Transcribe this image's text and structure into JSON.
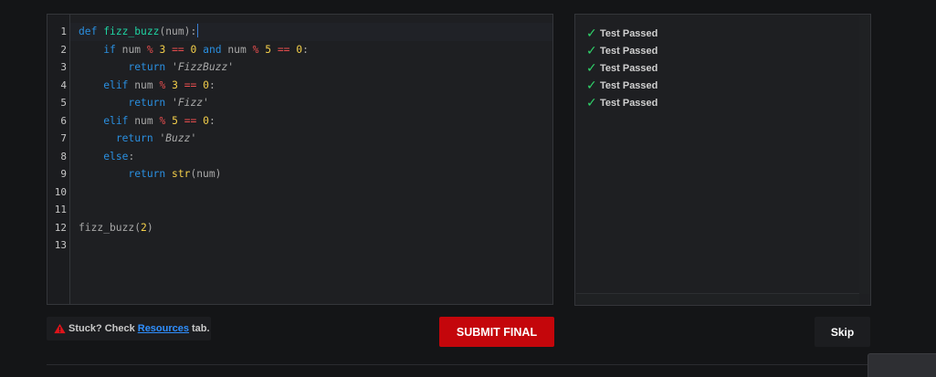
{
  "editor": {
    "line_numbers": [
      "1",
      "2",
      "3",
      "4",
      "5",
      "6",
      "7",
      "8",
      "9",
      "10",
      "11",
      "12",
      "13"
    ],
    "code": {
      "l1": {
        "kw": "def",
        "fn": "fizz_buzz",
        "rest": "(num):"
      },
      "l2": {
        "kw_if": "if",
        "var1": "num",
        "op1": "%",
        "n1": "3",
        "op2": "==",
        "n2": "0",
        "kw_and": "and",
        "var2": "num",
        "op3": "%",
        "n3": "5",
        "op4": "==",
        "n4": "0",
        "colon": ":"
      },
      "l3": {
        "kw": "return",
        "str": "'FizzBuzz'"
      },
      "l4": {
        "kw": "elif",
        "var": "num",
        "op1": "%",
        "n1": "3",
        "op2": "==",
        "n2": "0",
        "colon": ":"
      },
      "l5": {
        "kw": "return",
        "str": "'Fizz'"
      },
      "l6": {
        "kw": "elif",
        "var": "num",
        "op1": "%",
        "n1": "5",
        "op2": "==",
        "n2": "0",
        "colon": ":"
      },
      "l7": {
        "kw": "return",
        "str": "'Buzz'"
      },
      "l8": {
        "kw": "else",
        "colon": ":"
      },
      "l9": {
        "kw": "return",
        "fn": "str",
        "rest": "(num)"
      },
      "l12": {
        "call": "fizz_buzz(",
        "n": "2",
        "close": ")"
      }
    }
  },
  "results": {
    "items": [
      "Test Passed",
      "Test Passed",
      "Test Passed",
      "Test Passed",
      "Test Passed"
    ],
    "check_icon": "check-icon",
    "check_color": "#2fd36a"
  },
  "hint": {
    "icon": "warning-icon",
    "prefix": "Stuck? Check",
    "link": "Resources",
    "suffix": "tab."
  },
  "actions": {
    "submit_label": "SUBMIT FINAL",
    "skip_label": "Skip"
  },
  "colors": {
    "submit": "#c4060b",
    "keyword": "#2a8fe0",
    "function": "#1fd3a2",
    "operator": "#e94e4e",
    "number": "#f4cf4a"
  }
}
